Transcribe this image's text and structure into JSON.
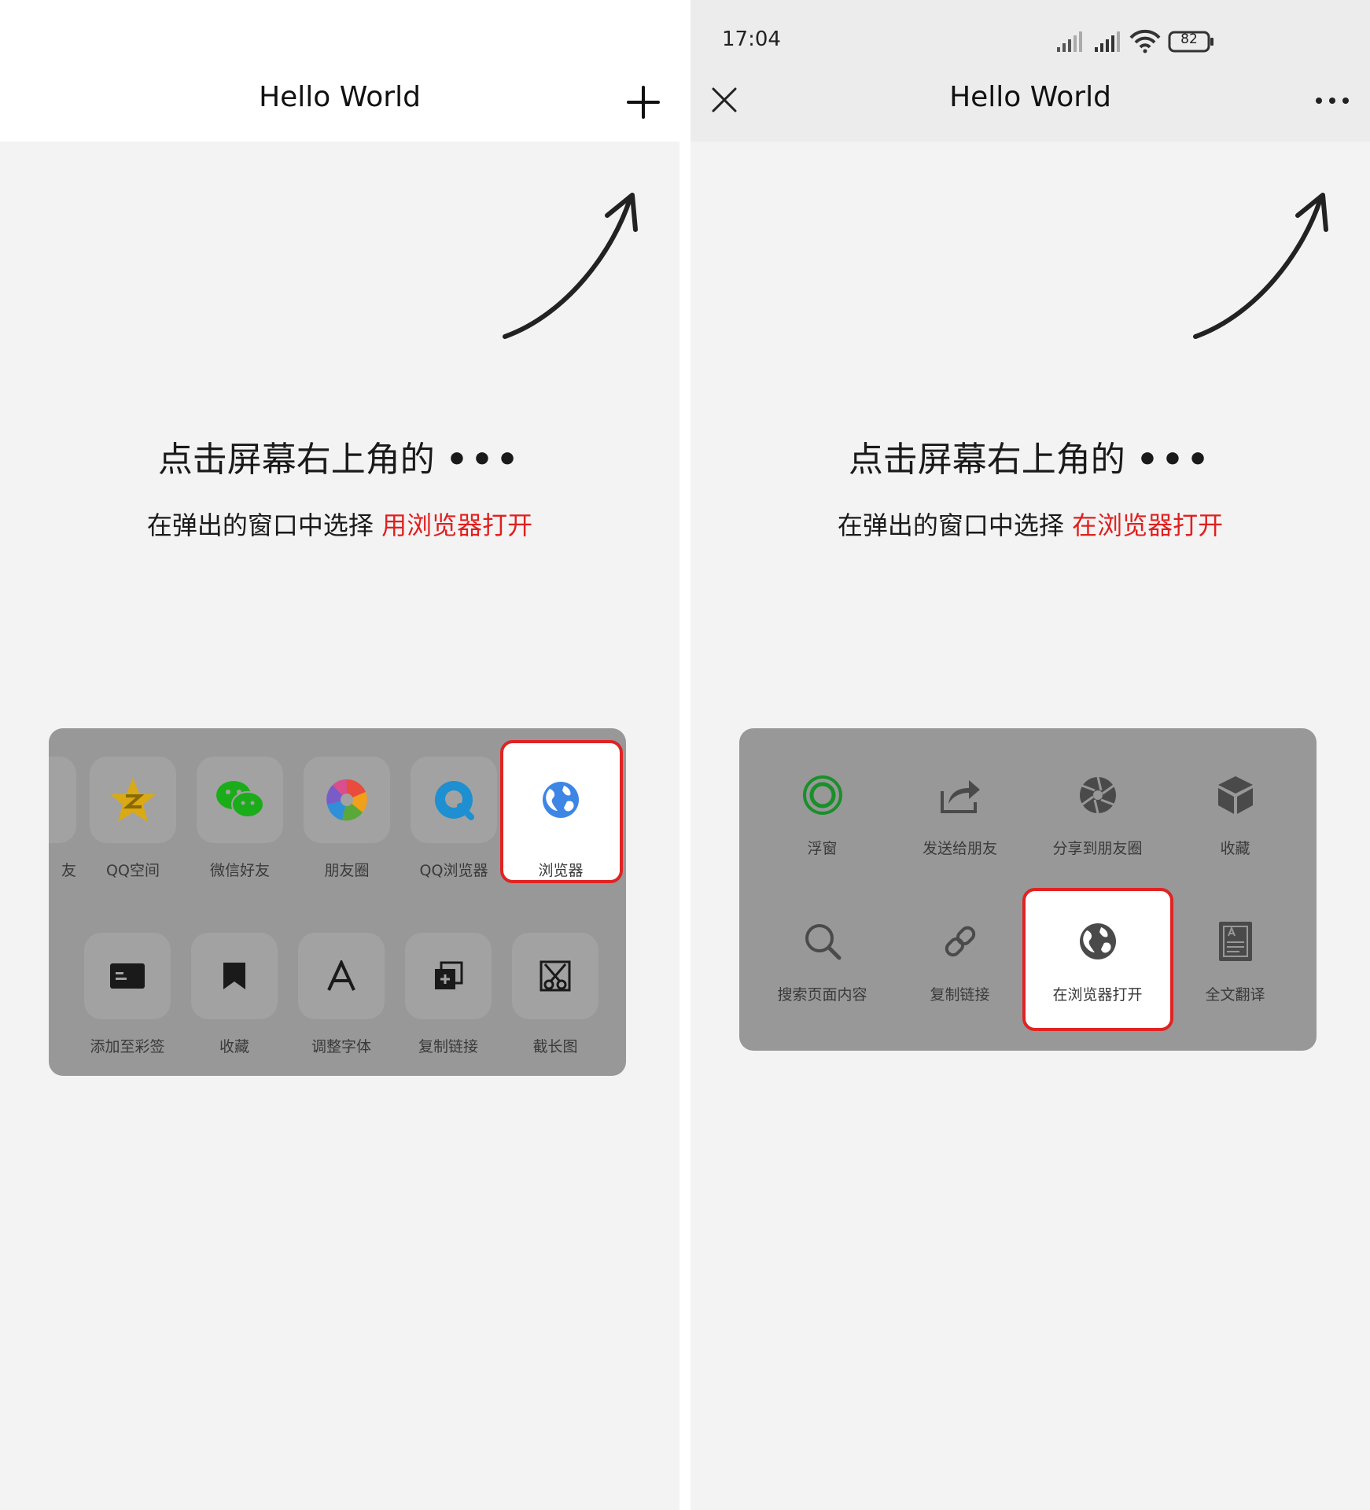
{
  "left": {
    "title": "Hello World",
    "plus_icon": "plus-icon",
    "hint_line1": "点击屏幕右上角的",
    "hint_dots": "•••",
    "hint_line2_prefix": "在弹出的窗口中选择",
    "hint_line2_highlight": "用浏览器打开",
    "row1": [
      {
        "label": "友",
        "icon": "partial-icon"
      },
      {
        "label": "QQ空间",
        "icon": "qzone-star-icon"
      },
      {
        "label": "微信好友",
        "icon": "wechat-icon"
      },
      {
        "label": "朋友圈",
        "icon": "moments-aperture-icon"
      },
      {
        "label": "QQ浏览器",
        "icon": "qq-browser-icon"
      },
      {
        "label": "浏览器",
        "icon": "globe-icon",
        "selected": true
      }
    ],
    "row2": [
      {
        "label": "添加至彩签",
        "icon": "tag-card-icon"
      },
      {
        "label": "收藏",
        "icon": "bookmark-icon"
      },
      {
        "label": "调整字体",
        "icon": "font-icon"
      },
      {
        "label": "复制链接",
        "icon": "copy-link-icon"
      },
      {
        "label": "截长图",
        "icon": "screenshot-scissors-icon"
      }
    ]
  },
  "right": {
    "status_time": "17:04",
    "battery": "82",
    "title": "Hello World",
    "close_icon": "close-icon",
    "more_icon": "more-dots-icon",
    "hint_line1": "点击屏幕右上角的",
    "hint_dots": "•••",
    "hint_line2_prefix": "在弹出的窗口中选择",
    "hint_line2_highlight": "在浏览器打开",
    "row1": [
      {
        "label": "浮窗",
        "icon": "float-window-icon"
      },
      {
        "label": "发送给朋友",
        "icon": "share-forward-icon"
      },
      {
        "label": "分享到朋友圈",
        "icon": "moments-aperture-icon"
      },
      {
        "label": "收藏",
        "icon": "cube-icon"
      }
    ],
    "row2": [
      {
        "label": "搜索页面内容",
        "icon": "search-icon"
      },
      {
        "label": "复制链接",
        "icon": "link-icon"
      },
      {
        "label": "在浏览器打开",
        "icon": "globe-icon",
        "selected": true
      },
      {
        "label": "全文翻译",
        "icon": "translate-doc-icon"
      }
    ]
  },
  "colors": {
    "highlight_red": "#e0201f",
    "sheet_bg": "#989898",
    "wechat_green": "#1aad19"
  }
}
